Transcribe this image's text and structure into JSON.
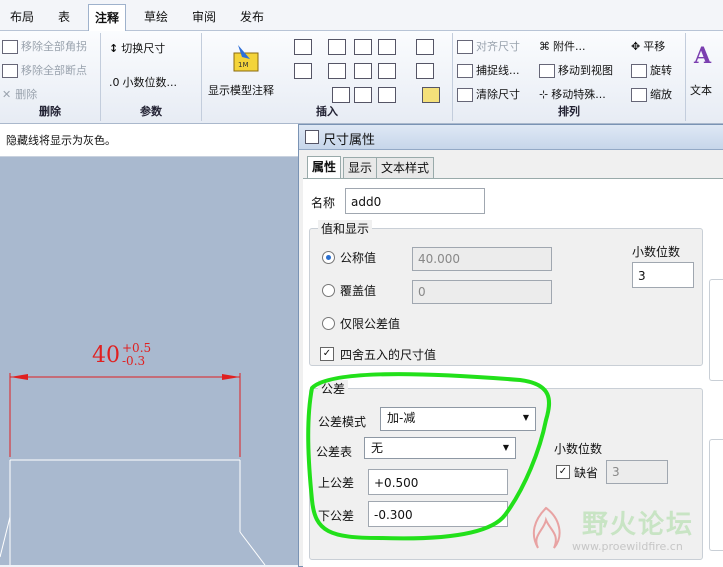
{
  "menu": {
    "tabs": [
      "布局",
      "表",
      "注释",
      "草绘",
      "审阅",
      "发布"
    ],
    "active": "注释"
  },
  "ribbon": {
    "delete_group": {
      "title": "删除",
      "items": [
        "移除全部角拐",
        "移除全部断点",
        "删除"
      ]
    },
    "params_group": {
      "title": "参数",
      "items": [
        "切换尺寸",
        "小数位数..."
      ]
    },
    "show_model_annotation": "显示模型注释",
    "insert_group": {
      "title": "插入"
    },
    "arrange_group": {
      "title": "排列",
      "items": [
        "对齐尺寸",
        "附件...",
        "平移",
        "捕捉线...",
        "移动到视图",
        "旋转",
        "清除尺寸",
        "移动特殊...",
        "缩放"
      ]
    },
    "text_label": "文本"
  },
  "hint": "隐藏线将显示为灰色。",
  "canvas": {
    "dimension_value": "40",
    "tol_upper": "+0.5",
    "tol_lower": "-0.3"
  },
  "dialog": {
    "title": "尺寸属性",
    "tabs": [
      "属性",
      "显示",
      "文本样式"
    ],
    "name_label": "名称",
    "name_value": "add0",
    "value_display": {
      "legend": "值和显示",
      "nominal_label": "公称值",
      "nominal_value": "40.000",
      "override_label": "覆盖值",
      "override_value": "0",
      "tol_only_label": "仅限公差值",
      "decimals_label": "小数位数",
      "decimals_value": "3",
      "round_label": "四舍五入的尺寸值"
    },
    "tolerance": {
      "legend": "公差",
      "mode_label": "公差模式",
      "mode_value": "加-减",
      "table_label": "公差表",
      "table_value": "无",
      "upper_label": "上公差",
      "upper_value": "+0.500",
      "lower_label": "下公差",
      "lower_value": "-0.300",
      "decimals_label": "小数位数",
      "default_label": "缺省",
      "default_value": "3"
    }
  },
  "watermark": {
    "text": "野火论坛",
    "url": "www.proewildfire.cn"
  },
  "colors": {
    "highlight": "#22e01a",
    "dimension": "#e02020",
    "canvas": "#a9b9cf"
  }
}
